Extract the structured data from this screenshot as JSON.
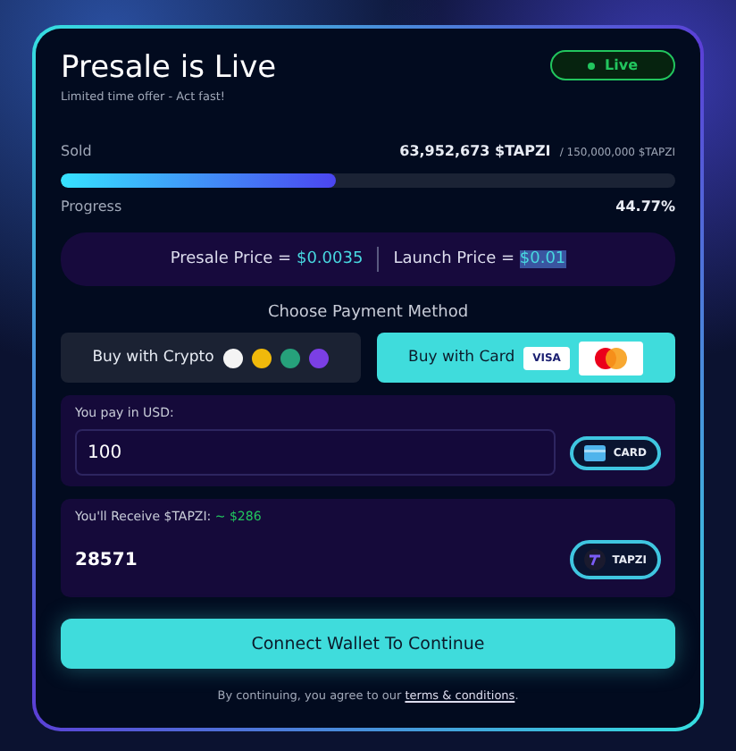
{
  "header": {
    "title": "Presale is Live",
    "subtitle": "Limited time offer - Act fast!",
    "status": {
      "label": "Live",
      "on": true
    }
  },
  "progress": {
    "sold_label": "Sold",
    "sold": "63,952,673 $TAPZI",
    "total": "/ 150,000,000 $TAPZI",
    "level": 0.4477,
    "progress_label": "Progress",
    "percent": "44.77%"
  },
  "prices": [
    {
      "label": "Presale Price =",
      "value": "$0.0035",
      "highlighted": false
    },
    {
      "label": "Launch Price =",
      "value": "$0.01",
      "highlighted": true
    }
  ],
  "payment": {
    "heading": "Choose Payment Method",
    "methods": [
      {
        "kind": "crypto",
        "label": "Buy with Crypto",
        "selected": false
      },
      {
        "kind": "card",
        "label": "Buy with Card",
        "selected": true,
        "badge": "VISA"
      }
    ]
  },
  "pay": {
    "label": "You pay in USD:",
    "value": "100",
    "currency": "CARD"
  },
  "receive": {
    "label": "You'll Receive $TAPZI:",
    "estimate": "~ $286",
    "value": "28571",
    "currency": "TAPZI"
  },
  "connect_button": "Connect Wallet To Continue",
  "footer": {
    "text": "By continuing, you agree to our",
    "link": "terms & conditions",
    "end": "."
  }
}
